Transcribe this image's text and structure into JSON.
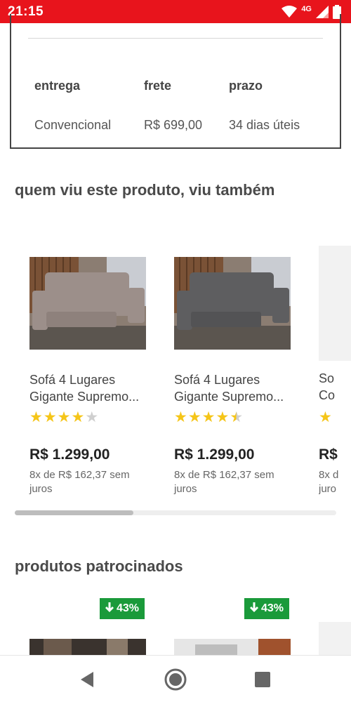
{
  "status_bar": {
    "time": "21:15",
    "network": "4G",
    "icons": [
      "wifi-icon",
      "signal-icon",
      "battery-icon"
    ],
    "color": "#e8141c"
  },
  "shipping": {
    "headers": [
      "entrega",
      "frete",
      "prazo"
    ],
    "row": [
      "Convencional",
      "R$ 699,00",
      "34 dias úteis"
    ]
  },
  "related": {
    "title": "quem viu este produto, viu também",
    "products": [
      {
        "name_line1": "Sofá 4 Lugares",
        "name_line2": "Gigante Supremo...",
        "rating": 4,
        "price": "R$ 1.299,00",
        "installments": "8x de R$ 162,37 sem juros",
        "sofa_color": "#9c8f8a"
      },
      {
        "name_line1": "Sofá 4 Lugares",
        "name_line2": "Gigante Supremo...",
        "rating": 4.5,
        "price": "R$ 1.299,00",
        "installments": "8x de R$ 162,37 sem juros",
        "sofa_color": "#5e5e60"
      }
    ],
    "peek": {
      "name_line1": "So",
      "name_line2": "Co",
      "price": "R$",
      "installments_line1": "8x d",
      "installments_line2": "juro"
    },
    "scroll_fraction": 0.37
  },
  "sponsored": {
    "title": "produtos patrocinados",
    "badges": [
      "43%",
      "43%"
    ],
    "badge_color": "#1a9a3a"
  },
  "nav": {
    "icons": [
      "back-icon",
      "home-icon",
      "recents-icon"
    ]
  }
}
